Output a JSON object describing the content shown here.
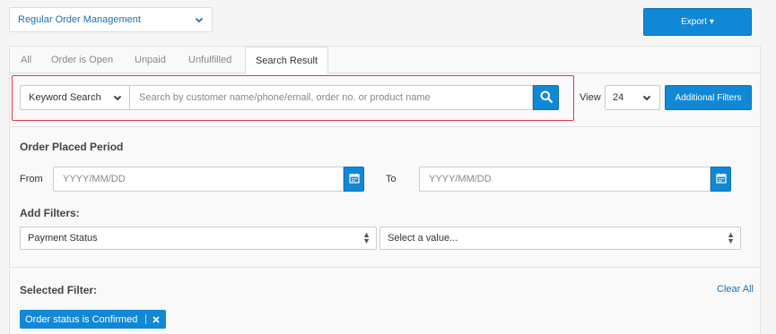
{
  "header": {
    "management_select": "Regular Order Management",
    "export_label": "Export ▾"
  },
  "tabs": [
    {
      "label": "All"
    },
    {
      "label": "Order is Open"
    },
    {
      "label": "Unpaid"
    },
    {
      "label": "Unfulfilled"
    },
    {
      "label": "Search Result",
      "active": true
    }
  ],
  "search": {
    "type_selected": "Keyword Search",
    "placeholder": "Search by customer name/phone/email, order no. or product name",
    "value": ""
  },
  "view": {
    "label": "View",
    "selected": "24"
  },
  "additional_filters_label": "Additional Filters",
  "order_period": {
    "heading": "Order Placed Period",
    "from_label": "From",
    "from_placeholder": "YYYY/MM/DD",
    "to_label": "To",
    "to_placeholder": "YYYY/MM/DD"
  },
  "add_filters": {
    "heading": "Add Filters:",
    "field_selected": "Payment Status",
    "value_selected": "Select a value..."
  },
  "selected_filter": {
    "heading": "Selected Filter:",
    "clear_all_label": "Clear All",
    "chips": [
      {
        "label": "Order status is Confirmed"
      }
    ]
  },
  "colors": {
    "accent": "#1088d6",
    "link": "#1f6fb5",
    "highlight_border": "#e0393e"
  }
}
